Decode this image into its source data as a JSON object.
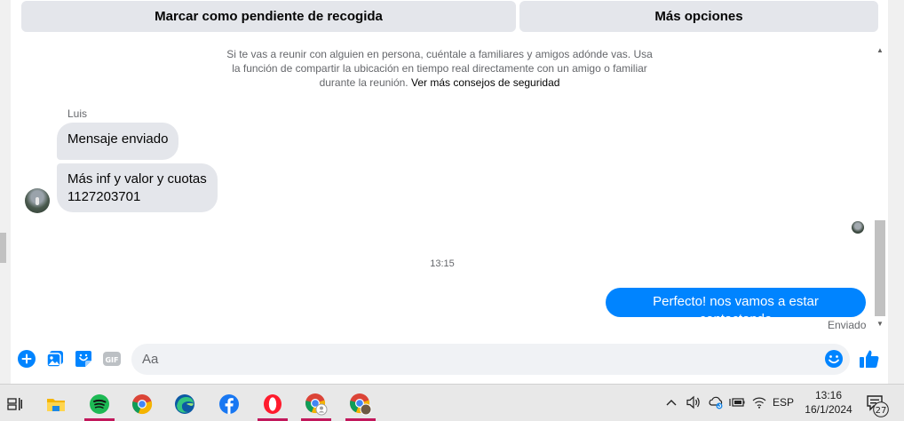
{
  "actions": {
    "mark_pending": "Marcar como pendiente de recogida",
    "more_options": "Más opciones"
  },
  "safety": {
    "text": "Si te vas a reunir con alguien en persona, cuéntale a familiares y amigos adónde vas. Usa la función de compartir la ubicación en tiempo real directamente con un amigo o familiar durante la reunión.",
    "link": "Ver más consejos de seguridad"
  },
  "thread": {
    "sender_name": "Luis",
    "incoming": [
      {
        "text": "Mensaje enviado"
      },
      {
        "line1": "Más inf y valor y cuotas",
        "line2": "1127203701"
      }
    ],
    "timestamp": "13:15",
    "outgoing": {
      "text": "Perfecto! nos vamos a estar contactando",
      "status": "Enviado"
    }
  },
  "composer": {
    "placeholder": "Aa",
    "value": "",
    "gif_label": "GIF"
  },
  "colors": {
    "accent": "#0084ff",
    "bubble_in": "#e4e6eb",
    "button_bg": "#e4e6eb",
    "secondary_text": "#65676b"
  },
  "taskbar": {
    "apps": [
      "task-view-icon",
      "file-explorer-icon",
      "spotify-icon",
      "chrome-icon",
      "edge-icon",
      "facebook-icon",
      "opera-icon",
      "chrome-profile-icon",
      "chrome-profile-icon"
    ],
    "language": "ESP",
    "time": "13:16",
    "date": "16/1/2024",
    "notifications": "27"
  }
}
